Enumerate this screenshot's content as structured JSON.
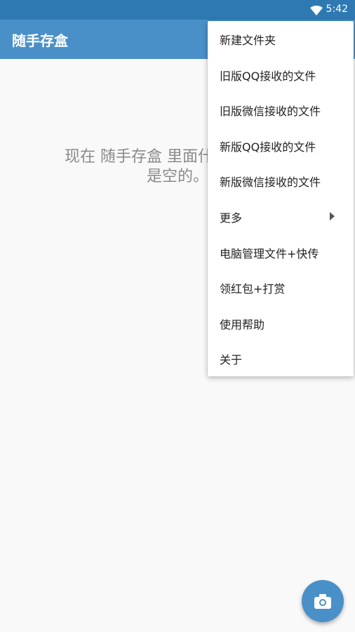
{
  "status_bar": {
    "time": "5:42",
    "wifi_icon": "wifi-icon"
  },
  "app_bar": {
    "title": "随手存盒"
  },
  "main": {
    "empty_message_line1": "现在 随手存盒 里面什么也没有。",
    "empty_message_line2": "是空的。"
  },
  "menu": {
    "items": [
      {
        "label": "新建文件夹"
      },
      {
        "label": "旧版QQ接收的文件"
      },
      {
        "label": "旧版微信接收的文件"
      },
      {
        "label": "新版QQ接收的文件"
      },
      {
        "label": "新版微信接收的文件"
      },
      {
        "label": "更多"
      },
      {
        "label": "电脑管理文件+快传"
      },
      {
        "label": "领红包+打赏"
      },
      {
        "label": "使用帮助"
      },
      {
        "label": "关于"
      }
    ]
  },
  "fab": {
    "icon": "camera-icon"
  },
  "colors": {
    "app_bar": "#4a90c8",
    "status_bar": "#2f79b3",
    "background": "#f9f9f9"
  }
}
